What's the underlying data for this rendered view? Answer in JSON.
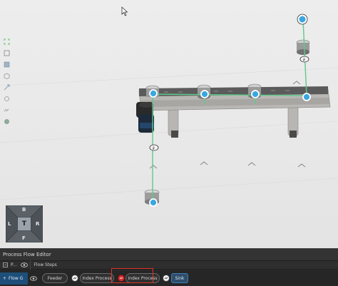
{
  "viewport": {
    "view_cube": {
      "top": "B",
      "left": "L",
      "right": "R",
      "bottom": "F",
      "center": "T"
    },
    "toolbar_icons": [
      "fit-view-icon",
      "frame-icon",
      "layers-icon",
      "box-icon",
      "vector-icon",
      "orbit-icon",
      "link-icon",
      "globe-icon"
    ]
  },
  "panel": {
    "title": "Process Flow Editor",
    "header": {
      "collapse_glyph": "−",
      "process_label": "P...",
      "steps_label": "Flow Steps"
    },
    "flow": {
      "name": "Flow G",
      "add_glyph": "+",
      "steps": [
        {
          "label": "Feeder"
        },
        {
          "label": "Index Process"
        },
        {
          "label": "Index Process"
        },
        {
          "label": "Sink"
        }
      ]
    }
  },
  "colors": {
    "accent": "#3aa7e0",
    "flow_line": "#5fc98a",
    "selection": "#e0332a",
    "flow_bg": "#1d4f7a"
  }
}
